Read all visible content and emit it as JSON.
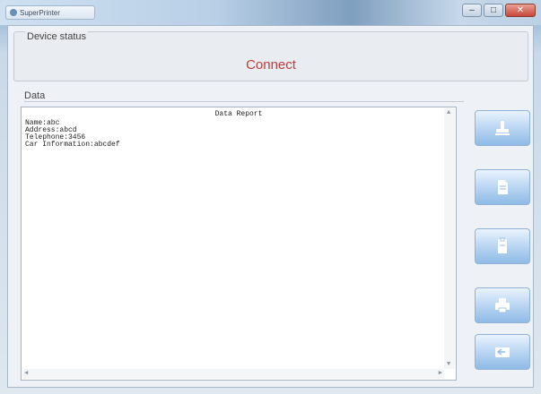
{
  "window": {
    "title": "SuperPrinter"
  },
  "device_status": {
    "label": "Device status",
    "value": "Connect"
  },
  "data_section": {
    "label": "Data",
    "report_title": "Data Report",
    "lines": [
      "Name:abc",
      "Address:abcd",
      "Telephone:3456",
      "Car Information:abcdef"
    ]
  },
  "side_buttons": [
    {
      "icon": "stamp-icon"
    },
    {
      "icon": "document-icon"
    },
    {
      "icon": "document-icon"
    },
    {
      "icon": "printer-icon"
    },
    {
      "icon": "export-icon"
    }
  ]
}
